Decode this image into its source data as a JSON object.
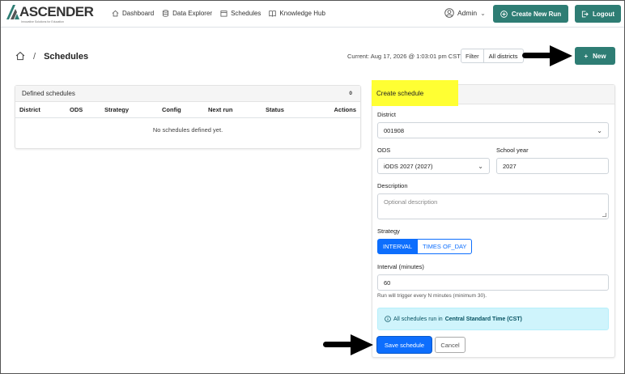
{
  "brand": {
    "name": "ASCENDER",
    "tagline": "Innovative Solutions for Education"
  },
  "nav": {
    "links": [
      {
        "label": "Dashboard",
        "icon": "home-icon"
      },
      {
        "label": "Data Explorer",
        "icon": "database-icon"
      },
      {
        "label": "Schedules",
        "icon": "calendar-icon"
      },
      {
        "label": "Knowledge Hub",
        "icon": "book-icon"
      }
    ],
    "user": "Admin",
    "create_run_label": "Create New Run",
    "logout_label": "Logout"
  },
  "page": {
    "title": "Schedules",
    "current": "Current: Aug 17, 2026 @ 1:03:01 pm CST",
    "filter_label": "Filter",
    "filter_value": "All districts",
    "new_label": "New"
  },
  "schedules_table": {
    "title": "Defined schedules",
    "count": "0",
    "columns": [
      "District",
      "ODS",
      "Strategy",
      "Config",
      "Next run",
      "Status",
      "Actions"
    ],
    "empty_text": "No schedules defined yet."
  },
  "create_form": {
    "title": "Create schedule",
    "district_label": "District",
    "district_value": "001908",
    "ods_label": "ODS",
    "ods_value": "iODS 2027 (2027)",
    "school_year_label": "School year",
    "school_year_value": "2027",
    "description_label": "Description",
    "description_placeholder": "Optional description",
    "strategy_label": "Strategy",
    "strategy_options": [
      "INTERVAL",
      "TIMES OF_DAY"
    ],
    "strategy_selected": "INTERVAL",
    "interval_label": "Interval (minutes)",
    "interval_value": "60",
    "interval_hint": "Run will trigger every N minutes (minimum 30).",
    "info_prefix": "All schedules run in",
    "info_timezone": "Central Standard Time (CST)",
    "save_label": "Save schedule",
    "cancel_label": "Cancel"
  },
  "colors": {
    "teal": "#2e7d74",
    "primary": "#0d6efd",
    "highlight": "#ffff33",
    "info_bg": "#cff4fc"
  }
}
